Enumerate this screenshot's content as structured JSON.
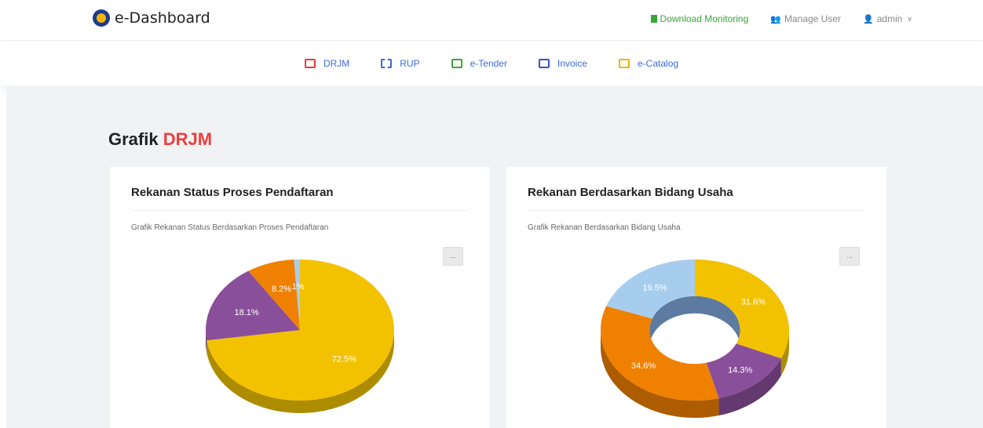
{
  "header": {
    "brand": "e-Dashboard",
    "download_label": "Download Monitoring",
    "manage_user_label": "Manage User",
    "user_label": "admin"
  },
  "nav": {
    "items": [
      {
        "label": "DRJM",
        "icon": "presentation-icon"
      },
      {
        "label": "RUP",
        "icon": "grid-icon"
      },
      {
        "label": "e-Tender",
        "icon": "document-icon"
      },
      {
        "label": "Invoice",
        "icon": "document-icon"
      },
      {
        "label": "e-Catalog",
        "icon": "document-icon"
      }
    ]
  },
  "page": {
    "title_prefix": "Grafik",
    "title_accent": "DRJM"
  },
  "cards": [
    {
      "title": "Rekanan Status Proses Pendaftaran",
      "subtitle": "Grafik Rekanan Status Berdasarkan Proses Pendaftaran",
      "menu_label": "..."
    },
    {
      "title": "Rekanan Berdasarkan Bidang Usaha",
      "subtitle": "Grafik Rekanan Berdasarkan Bidang Usaha",
      "menu_label": "..."
    }
  ],
  "chart_data": [
    {
      "type": "pie",
      "values": [
        72.5,
        18.1,
        8.2,
        1
      ],
      "labels": [
        "72.5%",
        "18.1%",
        "8.2%",
        "1%"
      ],
      "colors": [
        "#f2c200",
        "#8a4f9a",
        "#f08000",
        "#a7cdee"
      ]
    },
    {
      "type": "pie",
      "style": "donut",
      "values": [
        31.6,
        14.3,
        34.6,
        19.5
      ],
      "labels": [
        "31.6%",
        "14.3%",
        "34.6%",
        "19.5%"
      ],
      "colors": [
        "#f2c200",
        "#8a4f9a",
        "#f08000",
        "#a7cdee"
      ]
    }
  ]
}
